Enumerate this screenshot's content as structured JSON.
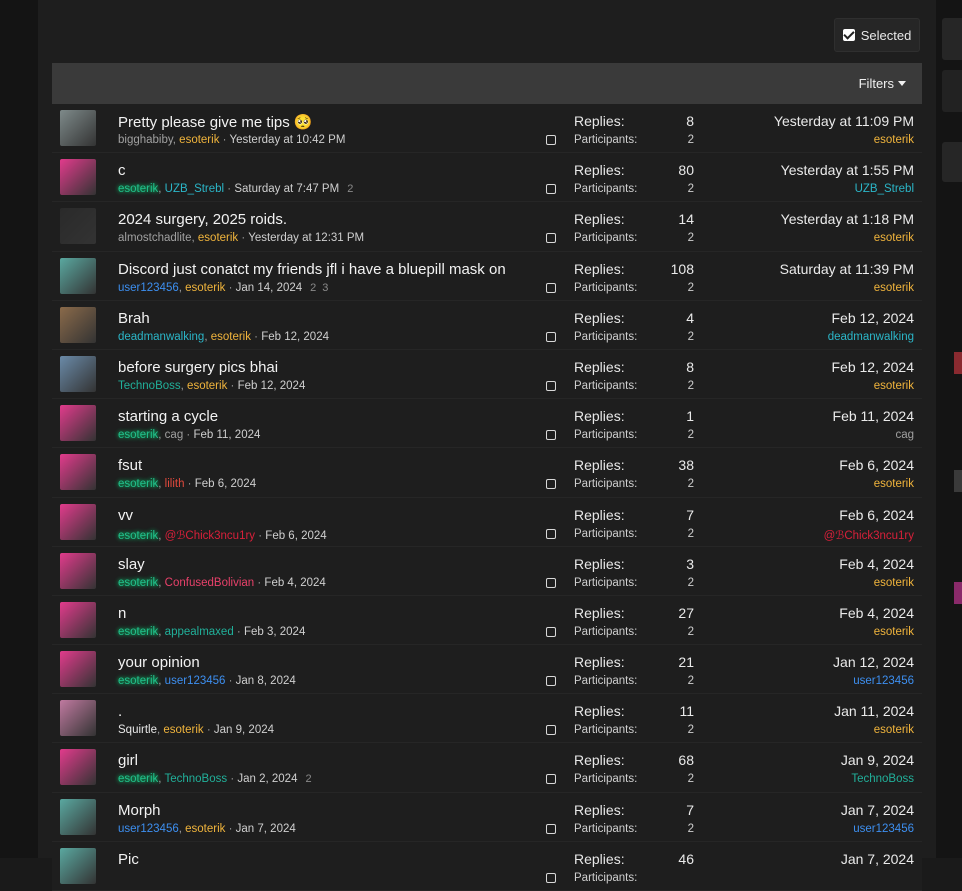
{
  "toolbar": {
    "selected_label": "Selected",
    "filters_label": "Filters"
  },
  "labels": {
    "replies": "Replies:",
    "participants": "Participants:"
  },
  "threads": [
    {
      "title": "Pretty please give me tips 🥺",
      "starter": "bigghabiby",
      "starter_color": "u-grey",
      "other": "esoterik",
      "other_color": "u-yellow",
      "date": "Yesterday at 10:42 PM",
      "pages": [],
      "replies": "8",
      "participants": "2",
      "last_date": "Yesterday at 11:09 PM",
      "last_user": "esoterik",
      "last_color": "u-yellow",
      "avatar": "#7e8a8a"
    },
    {
      "title": "c",
      "starter": "esoterik",
      "starter_color": "u-glow",
      "other": "UZB_Strebl",
      "other_color": "u-cyan",
      "date": "Saturday at 7:47 PM",
      "pages": [
        "2"
      ],
      "replies": "80",
      "participants": "2",
      "last_date": "Yesterday at 1:55 PM",
      "last_user": "UZB_Strebl",
      "last_color": "u-cyan",
      "avatar": "#e23b8c"
    },
    {
      "title": "2024 surgery, 2025 roids.",
      "starter": "almostchadlite",
      "starter_color": "u-grey",
      "other": "esoterik",
      "other_color": "u-yellow",
      "date": "Yesterday at 12:31 PM",
      "pages": [],
      "replies": "14",
      "participants": "2",
      "last_date": "Yesterday at 1:18 PM",
      "last_user": "esoterik",
      "last_color": "u-yellow",
      "avatar": "#2a2a2a"
    },
    {
      "title": "Discord just conatct my friends jfl i have a bluepill mask on",
      "starter": "user123456",
      "starter_color": "u-blue",
      "other": "esoterik",
      "other_color": "u-yellow",
      "date": "Jan 14, 2024",
      "pages": [
        "2",
        "3"
      ],
      "replies": "108",
      "participants": "2",
      "last_date": "Saturday at 11:39 PM",
      "last_user": "esoterik",
      "last_color": "u-yellow",
      "avatar": "#5aa8a0"
    },
    {
      "title": "Brah",
      "starter": "deadmanwalking",
      "starter_color": "u-cyan",
      "other": "esoterik",
      "other_color": "u-yellow",
      "date": "Feb 12, 2024",
      "pages": [],
      "replies": "4",
      "participants": "2",
      "last_date": "Feb 12, 2024",
      "last_user": "deadmanwalking",
      "last_color": "u-cyan",
      "avatar": "#8a6a4a"
    },
    {
      "title": "before surgery pics bhai",
      "starter": "TechnoBoss",
      "starter_color": "u-teal",
      "other": "esoterik",
      "other_color": "u-yellow",
      "date": "Feb 12, 2024",
      "pages": [],
      "replies": "8",
      "participants": "2",
      "last_date": "Feb 12, 2024",
      "last_user": "esoterik",
      "last_color": "u-yellow",
      "avatar": "#6a8aa8"
    },
    {
      "title": "starting a cycle",
      "starter": "esoterik",
      "starter_color": "u-glow",
      "other": "cag",
      "other_color": "u-grey",
      "date": "Feb 11, 2024",
      "pages": [],
      "replies": "1",
      "participants": "2",
      "last_date": "Feb 11, 2024",
      "last_user": "cag",
      "last_color": "u-grey",
      "avatar": "#e23b8c"
    },
    {
      "title": "fsut",
      "starter": "esoterik",
      "starter_color": "u-glow",
      "other": "lilith",
      "other_color": "u-red",
      "date": "Feb 6, 2024",
      "pages": [],
      "replies": "38",
      "participants": "2",
      "last_date": "Feb 6, 2024",
      "last_user": "esoterik",
      "last_color": "u-yellow",
      "avatar": "#e23b8c"
    },
    {
      "title": "vv",
      "starter": "esoterik",
      "starter_color": "u-glow",
      "other": "@ℬChick3ncu1ry",
      "other_color": "u-crimson",
      "date": "Feb 6, 2024",
      "pages": [],
      "replies": "7",
      "participants": "2",
      "last_date": "Feb 6, 2024",
      "last_user": "@ℬChick3ncu1ry",
      "last_color": "u-crimson",
      "avatar": "#e23b8c"
    },
    {
      "title": "slay",
      "starter": "esoterik",
      "starter_color": "u-glow",
      "other": "ConfusedBolivian",
      "other_color": "u-pink",
      "date": "Feb 4, 2024",
      "pages": [],
      "replies": "3",
      "participants": "2",
      "last_date": "Feb 4, 2024",
      "last_user": "esoterik",
      "last_color": "u-yellow",
      "avatar": "#e23b8c"
    },
    {
      "title": "n",
      "starter": "esoterik",
      "starter_color": "u-glow",
      "other": "appealmaxed",
      "other_color": "u-teal",
      "date": "Feb 3, 2024",
      "pages": [],
      "replies": "27",
      "participants": "2",
      "last_date": "Feb 4, 2024",
      "last_user": "esoterik",
      "last_color": "u-yellow",
      "avatar": "#e23b8c"
    },
    {
      "title": "your opinion",
      "starter": "esoterik",
      "starter_color": "u-glow",
      "other": "user123456",
      "other_color": "u-blue",
      "date": "Jan 8, 2024",
      "pages": [],
      "replies": "21",
      "participants": "2",
      "last_date": "Jan 12, 2024",
      "last_user": "user123456",
      "last_color": "u-blue",
      "avatar": "#e23b8c"
    },
    {
      "title": ".",
      "starter": "Squirtle",
      "starter_color": "u-white",
      "other": "esoterik",
      "other_color": "u-yellow",
      "date": "Jan 9, 2024",
      "pages": [],
      "replies": "11",
      "participants": "2",
      "last_date": "Jan 11, 2024",
      "last_user": "esoterik",
      "last_color": "u-yellow",
      "avatar": "#c07aa0"
    },
    {
      "title": "girl",
      "starter": "esoterik",
      "starter_color": "u-glow",
      "other": "TechnoBoss",
      "other_color": "u-teal",
      "date": "Jan 2, 2024",
      "pages": [
        "2"
      ],
      "replies": "68",
      "participants": "2",
      "last_date": "Jan 9, 2024",
      "last_user": "TechnoBoss",
      "last_color": "u-teal",
      "avatar": "#e23b8c"
    },
    {
      "title": "Morph",
      "starter": "user123456",
      "starter_color": "u-blue",
      "other": "esoterik",
      "other_color": "u-yellow",
      "date": "Jan 7, 2024",
      "pages": [],
      "replies": "7",
      "participants": "2",
      "last_date": "Jan 7, 2024",
      "last_user": "user123456",
      "last_color": "u-blue",
      "avatar": "#5aa8a0"
    },
    {
      "title": "Pic",
      "starter": "",
      "starter_color": "u-grey",
      "other": "",
      "other_color": "u-grey",
      "date": "",
      "pages": [],
      "replies": "46",
      "participants": "",
      "last_date": "Jan 7, 2024",
      "last_user": "",
      "last_color": "u-grey",
      "avatar": "#5aa8a0"
    }
  ]
}
